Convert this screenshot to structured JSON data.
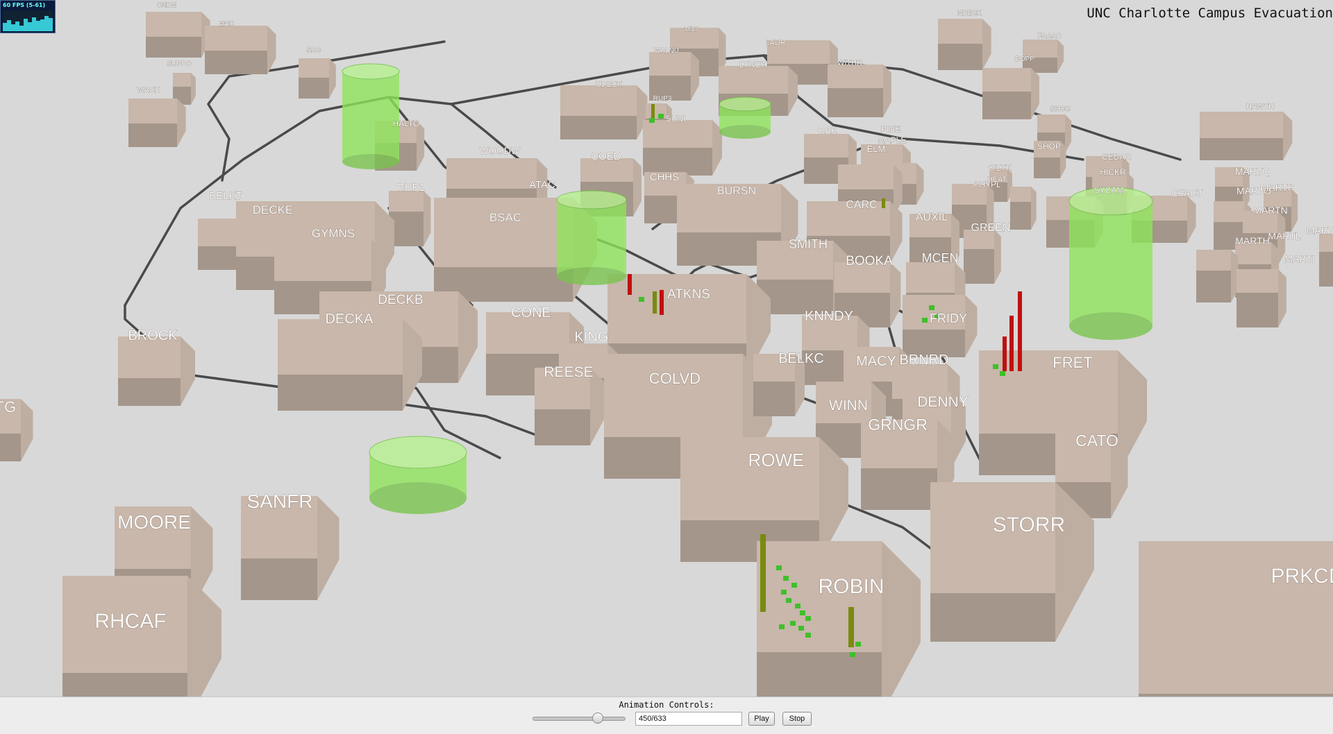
{
  "app": {
    "title": "UNC Charlotte Campus Evacuation"
  },
  "fps": {
    "label": "60 FPS (5-61)"
  },
  "controls": {
    "label": "Animation Controls:",
    "slider_value": 0.71,
    "frame_value": "450/633",
    "play_label": "Play",
    "stop_label": "Stop"
  },
  "colors": {
    "background": "#d8d8d8",
    "building": "#c8b7aa",
    "path": "#4a4a4a",
    "safe_zone": "#8ee65a",
    "evacuee_moving": "#7a8a10",
    "evacuee_safe": "#3fbf2a",
    "evacuee_alert": "#c01010"
  },
  "buildings": [
    {
      "name": "CRIDE"
    },
    {
      "name": "EPIC"
    },
    {
      "name": "SUPPO"
    },
    {
      "name": "SAC"
    },
    {
      "name": "WACH"
    },
    {
      "name": "HALTO"
    },
    {
      "name": "MILT"
    },
    {
      "name": "WALNU"
    },
    {
      "name": "LAUR"
    },
    {
      "name": "LYNCH"
    },
    {
      "name": "WITHR"
    },
    {
      "name": "NDECK"
    },
    {
      "name": "FACAO"
    },
    {
      "name": "BOPP"
    },
    {
      "name": "UDECK"
    },
    {
      "name": "RUP3"
    },
    {
      "name": "SUNI"
    },
    {
      "name": "SHCC"
    },
    {
      "name": "HAWTH"
    },
    {
      "name": "OAK"
    },
    {
      "name": "PINE"
    },
    {
      "name": "MAPLE"
    },
    {
      "name": "ELM"
    },
    {
      "name": "SHOP"
    },
    {
      "name": "CEDAR"
    },
    {
      "name": "OILTK"
    },
    {
      "name": "HICKR"
    },
    {
      "name": "PHYPL"
    },
    {
      "name": "HEAT"
    },
    {
      "name": "SYCAM"
    },
    {
      "name": "CFACT"
    },
    {
      "name": "MARTQ"
    },
    {
      "name": "MARTO"
    },
    {
      "name": "MARTP"
    },
    {
      "name": "MARTN"
    },
    {
      "name": "MARTL"
    },
    {
      "name": "MARTH"
    },
    {
      "name": "MARTI"
    },
    {
      "name": "MARTJ"
    },
    {
      "name": "WOODW"
    },
    {
      "name": "COED"
    },
    {
      "name": "CHHS"
    },
    {
      "name": "BURSN"
    },
    {
      "name": "CARC"
    },
    {
      "name": "AUXIL"
    },
    {
      "name": "GREEN"
    },
    {
      "name": "ATAC"
    },
    {
      "name": "RUP1"
    },
    {
      "name": "BELKT"
    },
    {
      "name": "DECKE"
    },
    {
      "name": "GYMNS"
    },
    {
      "name": "BSAC"
    },
    {
      "name": "SMITH"
    },
    {
      "name": "BOOKA"
    },
    {
      "name": "MCEN"
    },
    {
      "name": "ATKNS"
    },
    {
      "name": "DECKB"
    },
    {
      "name": "DECKA"
    },
    {
      "name": "CONE"
    },
    {
      "name": "KNNDY"
    },
    {
      "name": "FRIDY"
    },
    {
      "name": "BROCK"
    },
    {
      "name": "KING"
    },
    {
      "name": "REESE"
    },
    {
      "name": "COLVD"
    },
    {
      "name": "BELKC"
    },
    {
      "name": "MACY"
    },
    {
      "name": "BRNRD"
    },
    {
      "name": "FRET"
    },
    {
      "name": "WINN"
    },
    {
      "name": "DENNY"
    },
    {
      "name": "GRNGR"
    },
    {
      "name": "CATO"
    },
    {
      "name": "ROWE"
    },
    {
      "name": "SANFR"
    },
    {
      "name": "MOORE"
    },
    {
      "name": "STORR"
    },
    {
      "name": "RHCAF"
    },
    {
      "name": "ROBIN"
    },
    {
      "name": "PRKCD"
    },
    {
      "name": "TG"
    }
  ]
}
